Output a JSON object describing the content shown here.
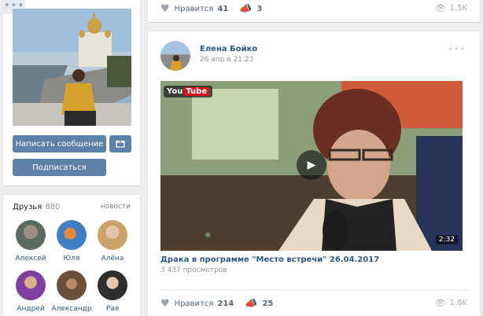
{
  "profile": {
    "write_message": "Написать сообщение",
    "subscribe": "Подписаться",
    "more": "•••"
  },
  "friends": {
    "title": "Друзья",
    "count": "880",
    "news_link": "новости",
    "items": [
      {
        "name": "Алексей"
      },
      {
        "name": "Юля"
      },
      {
        "name": "Алёна"
      },
      {
        "name": "Андрей"
      },
      {
        "name": "Александр"
      },
      {
        "name": "Рая"
      }
    ]
  },
  "top_post": {
    "like_label": "Нравится",
    "likes": "41",
    "shares": "3",
    "views": "1.5K"
  },
  "post": {
    "author": "Елена Бойко",
    "date": "26 апр в 21:23",
    "menu": "•••",
    "video": {
      "logo": "You",
      "logo_tube": "Tube",
      "duration": "2:32",
      "title": "Драка в программе \"Место встречи\" 26.04.2017",
      "views": "3 437 просмотров"
    },
    "like_label": "Нравится",
    "likes": "214",
    "shares": "25",
    "view_count": "1.8K"
  },
  "icons": {
    "heart": "heart-icon",
    "share": "megaphone-icon",
    "eye": "eye-icon",
    "gift": "gift-icon",
    "play": "play-icon"
  },
  "colors": {
    "accent": "#5e81a8",
    "link": "#2a5885",
    "background": "#edeef0"
  }
}
